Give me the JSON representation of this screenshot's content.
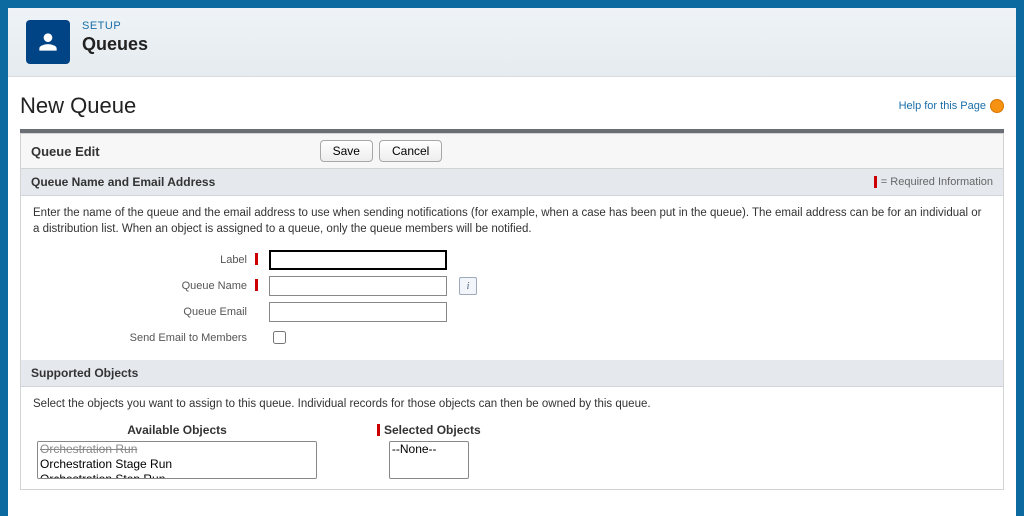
{
  "header": {
    "eyebrow": "SETUP",
    "title": "Queues"
  },
  "page": {
    "title": "New Queue",
    "help_link": "Help for this Page"
  },
  "toolbar": {
    "title": "Queue Edit",
    "save_label": "Save",
    "cancel_label": "Cancel"
  },
  "section1": {
    "header": "Queue Name and Email Address",
    "required_note": "= Required Information",
    "description": "Enter the name of the queue and the email address to use when sending notifications (for example, when a case has been put in the queue). The email address can be for an individual or a distribution list. When an object is assigned to a queue, only the queue members will be notified.",
    "fields": {
      "label": {
        "label": "Label",
        "value": "",
        "required": true
      },
      "queue_name": {
        "label": "Queue Name",
        "value": "",
        "required": true
      },
      "queue_email": {
        "label": "Queue Email",
        "value": "",
        "required": false
      },
      "send_email": {
        "label": "Send Email to Members",
        "checked": false
      }
    }
  },
  "section2": {
    "header": "Supported Objects",
    "description": "Select the objects you want to assign to this queue. Individual records for those objects can then be owned by this queue.",
    "available": {
      "title": "Available Objects",
      "options": [
        "Orchestration Run",
        "Orchestration Stage Run",
        "Orchestration Step Run"
      ]
    },
    "selected": {
      "title": "Selected Objects",
      "options": [
        "--None--"
      ]
    }
  }
}
